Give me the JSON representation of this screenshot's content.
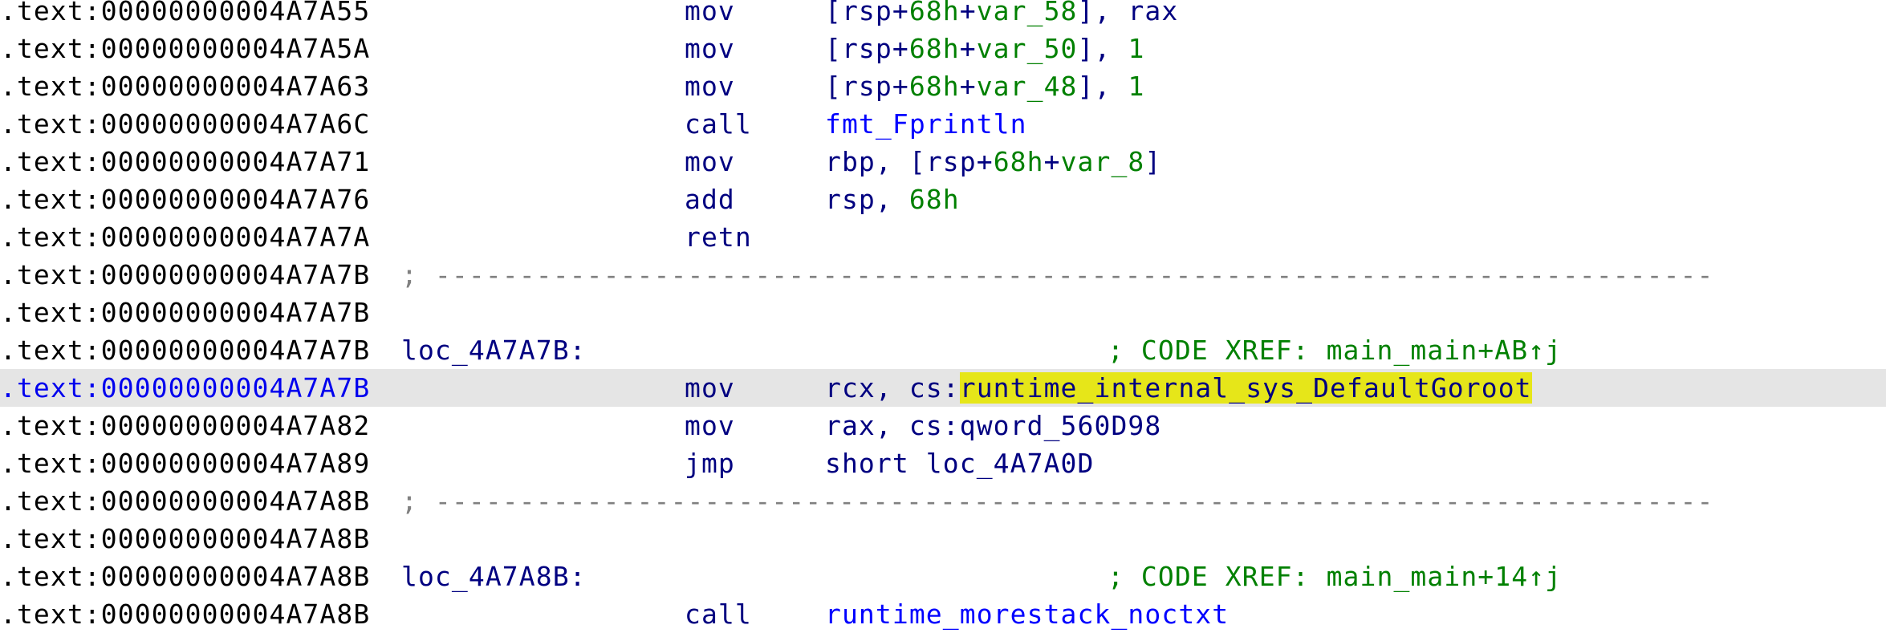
{
  "highlight_color": "#e6e619",
  "selection_color": "#e5e5e5",
  "lines": [
    {
      "addr": ".text:00000000004A7A55",
      "mnem": "mov",
      "ops": [
        [
          "[",
          "p"
        ],
        [
          "rsp",
          "r"
        ],
        [
          "+",
          "p"
        ],
        [
          "68h",
          "n"
        ],
        [
          "+",
          "p"
        ],
        [
          "var_58",
          "v"
        ],
        [
          "], ",
          "p"
        ],
        [
          "rax",
          "r"
        ]
      ]
    },
    {
      "addr": ".text:00000000004A7A5A",
      "mnem": "mov",
      "ops": [
        [
          "[",
          "p"
        ],
        [
          "rsp",
          "r"
        ],
        [
          "+",
          "p"
        ],
        [
          "68h",
          "n"
        ],
        [
          "+",
          "p"
        ],
        [
          "var_50",
          "v"
        ],
        [
          "], ",
          "p"
        ],
        [
          "1",
          "n"
        ]
      ]
    },
    {
      "addr": ".text:00000000004A7A63",
      "mnem": "mov",
      "ops": [
        [
          "[",
          "p"
        ],
        [
          "rsp",
          "r"
        ],
        [
          "+",
          "p"
        ],
        [
          "68h",
          "n"
        ],
        [
          "+",
          "p"
        ],
        [
          "var_48",
          "v"
        ],
        [
          "], ",
          "p"
        ],
        [
          "1",
          "n"
        ]
      ]
    },
    {
      "addr": ".text:00000000004A7A6C",
      "mnem": "call",
      "ops": [
        [
          "fmt_Fprintln",
          "f"
        ]
      ]
    },
    {
      "addr": ".text:00000000004A7A71",
      "mnem": "mov",
      "ops": [
        [
          "rbp",
          "r"
        ],
        [
          ", [",
          "p"
        ],
        [
          "rsp",
          "r"
        ],
        [
          "+",
          "p"
        ],
        [
          "68h",
          "n"
        ],
        [
          "+",
          "p"
        ],
        [
          "var_8",
          "v"
        ],
        [
          "]",
          "p"
        ]
      ]
    },
    {
      "addr": ".text:00000000004A7A76",
      "mnem": "add",
      "ops": [
        [
          "rsp",
          "r"
        ],
        [
          ", ",
          "p"
        ],
        [
          "68h",
          "n"
        ]
      ]
    },
    {
      "addr": ".text:00000000004A7A7A",
      "mnem": "retn",
      "ops": []
    },
    {
      "addr": ".text:00000000004A7A7B",
      "sep": "; ----------------------------------------------------------------------------"
    },
    {
      "addr": ".text:00000000004A7A7B"
    },
    {
      "addr": ".text:00000000004A7A7B",
      "label": "loc_4A7A7B:",
      "xref": "; CODE XREF: main_main+AB↑j"
    },
    {
      "addr": ".text:00000000004A7A7B",
      "selected": true,
      "mnem": "mov",
      "ops": [
        [
          "rcx",
          "r"
        ],
        [
          ", cs:",
          "p"
        ],
        [
          "runtime_internal_sys_DefaultGoroot",
          "h"
        ]
      ]
    },
    {
      "addr": ".text:00000000004A7A82",
      "mnem": "mov",
      "ops": [
        [
          "rax",
          "r"
        ],
        [
          ", cs:qword_560D98",
          "p"
        ]
      ]
    },
    {
      "addr": ".text:00000000004A7A89",
      "mnem": "jmp",
      "ops": [
        [
          "short loc_4A7A0D",
          "p"
        ]
      ]
    },
    {
      "addr": ".text:00000000004A7A8B",
      "sep": "; ----------------------------------------------------------------------------"
    },
    {
      "addr": ".text:00000000004A7A8B"
    },
    {
      "addr": ".text:00000000004A7A8B",
      "label": "loc_4A7A8B:",
      "xref": "; CODE XREF: main_main+14↑j"
    },
    {
      "addr": ".text:00000000004A7A8B",
      "mnem": "call",
      "ops": [
        [
          "runtime_morestack_noctxt",
          "f"
        ]
      ]
    }
  ]
}
